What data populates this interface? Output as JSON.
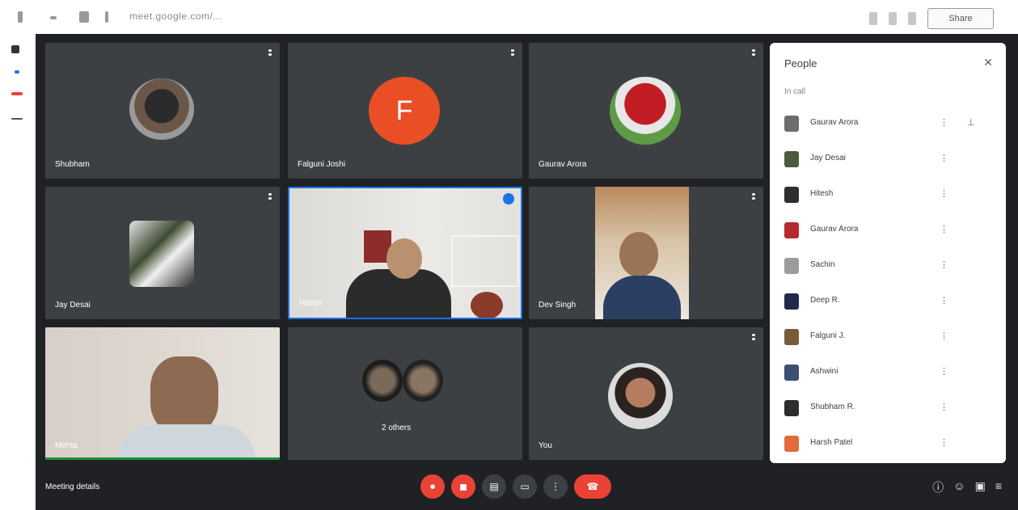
{
  "browser": {
    "url": "meet.google.com/...",
    "top_button_label": "Share"
  },
  "tiles": [
    {
      "name": "Shubham"
    },
    {
      "name": "Falguni Joshi"
    },
    {
      "name": "Gaurav Arora"
    },
    {
      "name": "Jay Desai"
    },
    {
      "name": "Hitesh"
    },
    {
      "name": "Dev Singh"
    },
    {
      "name": "Mehta"
    },
    {
      "name": "2 others"
    },
    {
      "name": "You"
    }
  ],
  "tile_initial": "F",
  "people": {
    "title": "People",
    "subtitle": "In call",
    "items": [
      {
        "name": "Gaurav Arora",
        "color": "#6d6d6d"
      },
      {
        "name": "Jay Desai",
        "color": "#4b5b3f"
      },
      {
        "name": "Hitesh",
        "color": "#2e2e2e"
      },
      {
        "name": "Gaurav Arora",
        "color": "#b52b2b"
      },
      {
        "name": "Sachin",
        "color": "#9c9c9c"
      },
      {
        "name": "Deep R.",
        "color": "#1e2a4a"
      },
      {
        "name": "Falguni J.",
        "color": "#7a5a3a"
      },
      {
        "name": "Ashwini",
        "color": "#3b4f74"
      },
      {
        "name": "Shubham R.",
        "color": "#2d2d2d"
      },
      {
        "name": "Harsh Patel",
        "color": "#e46a3a"
      }
    ]
  },
  "bottom": {
    "meeting_code": "Meeting details"
  },
  "colors": {
    "accent": "#1a73e8",
    "red": "#ea4335",
    "tile": "#3c4043",
    "bg": "#202124"
  }
}
